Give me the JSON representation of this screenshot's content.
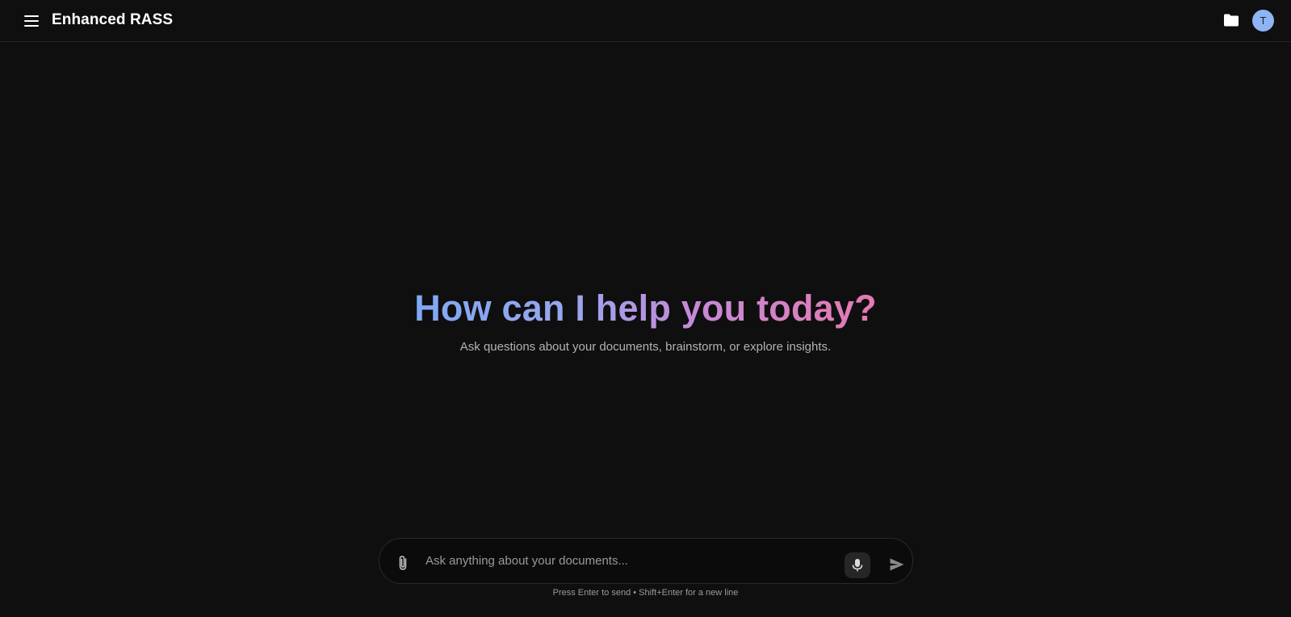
{
  "header": {
    "app_title": "Enhanced RASS",
    "avatar_initial": "T",
    "icons": {
      "menu": "hamburger-menu-icon",
      "folder": "folder-icon"
    }
  },
  "hero": {
    "title": "How can I help you today?",
    "subtitle": "Ask questions about your documents, brainstorm, or explore insights."
  },
  "composer": {
    "placeholder": "Ask anything about your documents...",
    "value": "",
    "hint": "Press Enter to send • Shift+Enter for a new line",
    "icons": {
      "attach": "paperclip-icon",
      "mic": "microphone-icon",
      "send": "send-icon"
    }
  },
  "colors": {
    "background": "#0f0f0f",
    "avatar": "#8fb4f5",
    "gradient_start": "#7fa8f4",
    "gradient_end": "#e579b0"
  }
}
